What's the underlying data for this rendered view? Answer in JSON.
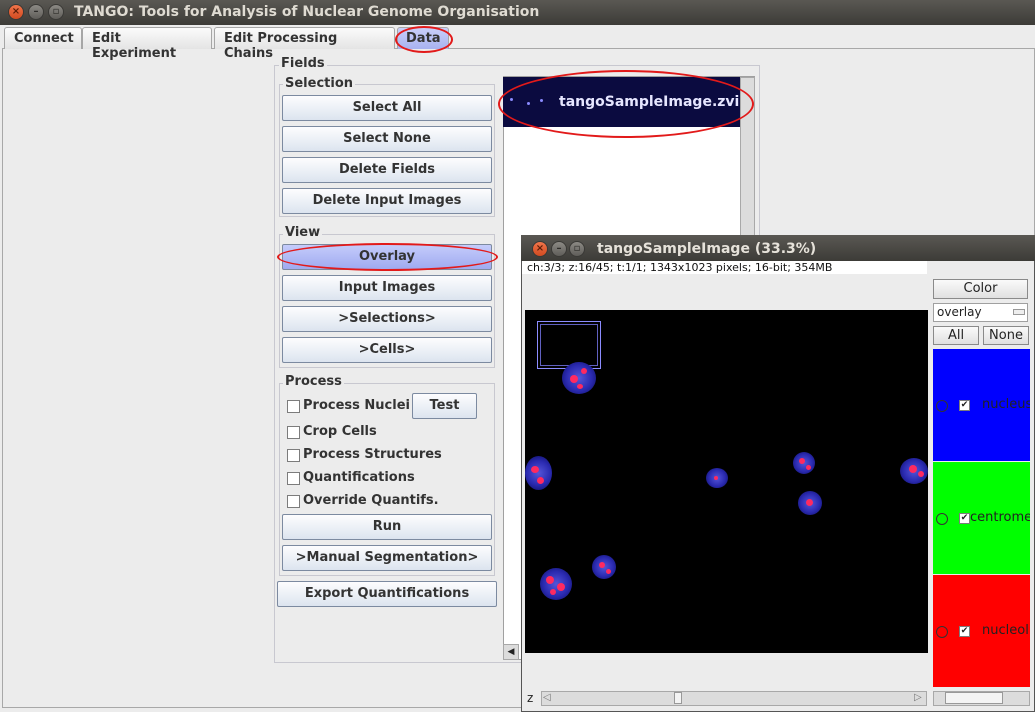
{
  "window": {
    "title": "TANGO: Tools for Analysis of Nuclear Genome Organisation"
  },
  "tabs": [
    {
      "label": "Connect"
    },
    {
      "label": "Edit Experiment"
    },
    {
      "label": "Edit Processing Chains"
    },
    {
      "label": "Data"
    }
  ],
  "fields": {
    "title": "Fields",
    "selection": {
      "label": "Selection",
      "buttons": [
        "Select All",
        "Select None",
        "Delete Fields",
        "Delete Input Images"
      ]
    },
    "view": {
      "label": "View",
      "buttons": [
        "Overlay",
        "Input Images",
        ">Selections>",
        ">Cells>"
      ]
    },
    "process": {
      "label": "Process",
      "checks": [
        "Process Nuclei",
        "Crop Cells",
        "Process Structures",
        "Quantifications",
        "Override Quantifs."
      ],
      "test_label": "Test",
      "run_label": "Run",
      "manual_label": ">Manual Segmentation>"
    },
    "export_label": "Export Quantifications"
  },
  "file_list": {
    "items": [
      "tangoSampleImage.zvi"
    ]
  },
  "image_window": {
    "title": "tangoSampleImage (33.3%)",
    "info": "ch:3/3; z:16/45; t:1/1; 1343x1023 pixels; 16-bit; 354MB",
    "z_label": "z",
    "color_button": "Color",
    "mode_select": "overlay",
    "all_label": "All",
    "none_label": "None",
    "channels": [
      {
        "name": "nucleus",
        "color": "#0000ff"
      },
      {
        "name": "centromeres",
        "color": "#00ff00"
      },
      {
        "name": "nucleoli",
        "color": "#ff0000"
      }
    ]
  },
  "colors": {
    "selection_bg": "#0b0b40",
    "highlight_ring": "#e21a1a",
    "active_button": "#a8b2f0"
  }
}
